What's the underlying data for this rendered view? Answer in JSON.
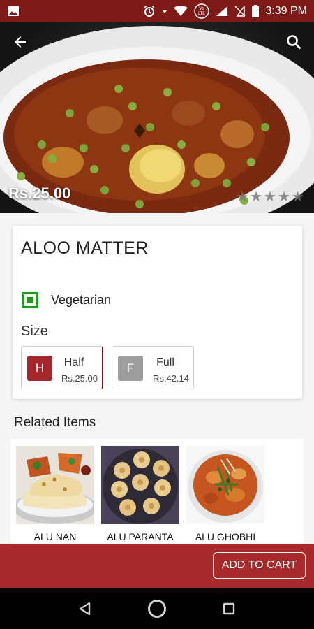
{
  "status_bar": {
    "time": "3:39 PM",
    "icons": [
      "image-icon",
      "alarm-icon",
      "data-arrows-icon",
      "wifi-icon",
      "volte-icon",
      "signal-icon",
      "no-sim-icon",
      "battery-icon"
    ],
    "volte_label": "VoLTE"
  },
  "hero": {
    "price": "Rs.25.00",
    "rating_stars": 5,
    "rating_value": 0,
    "icons": {
      "back": "arrow-back-icon",
      "search": "search-icon"
    }
  },
  "product": {
    "name": "ALOO MATTER",
    "diet_label": "Vegetarian",
    "diet_color": "#1e9a1e",
    "size_label": "Size",
    "sizes": [
      {
        "badge": "H",
        "name": "Half",
        "price": "Rs.25.00",
        "selected": true,
        "badge_color": "#a3262b"
      },
      {
        "badge": "F",
        "name": "Full",
        "price": "Rs.42.14",
        "selected": false,
        "badge_color": "#9e9e9e"
      }
    ]
  },
  "related": {
    "title": "Related Items",
    "items": [
      {
        "name": "ALU NAN"
      },
      {
        "name": "ALU PARANTA"
      },
      {
        "name": "ALU GHOBHI"
      }
    ]
  },
  "cart": {
    "button_label": "ADD TO CART"
  },
  "theme": {
    "primary_dark": "#7d1a17",
    "primary": "#a82a2d"
  },
  "nav": [
    "back-triangle-icon",
    "home-circle-icon",
    "recents-square-icon"
  ]
}
